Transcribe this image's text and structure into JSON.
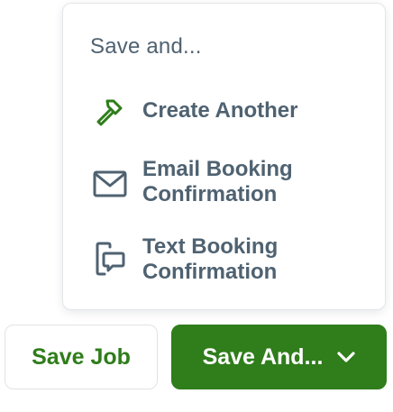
{
  "menu": {
    "header": "Save and...",
    "items": [
      {
        "label": "Create Another",
        "icon": "hammer-icon"
      },
      {
        "label": "Email Booking Confirmation",
        "icon": "envelope-icon"
      },
      {
        "label": "Text Booking Confirmation",
        "icon": "phone-message-icon"
      }
    ]
  },
  "buttons": {
    "save_job": "Save Job",
    "save_and": "Save And..."
  },
  "colors": {
    "brand_green": "#2f7d1b",
    "text_slate": "#4f6271",
    "border": "#e3e6e9",
    "background": "#ffffff"
  }
}
